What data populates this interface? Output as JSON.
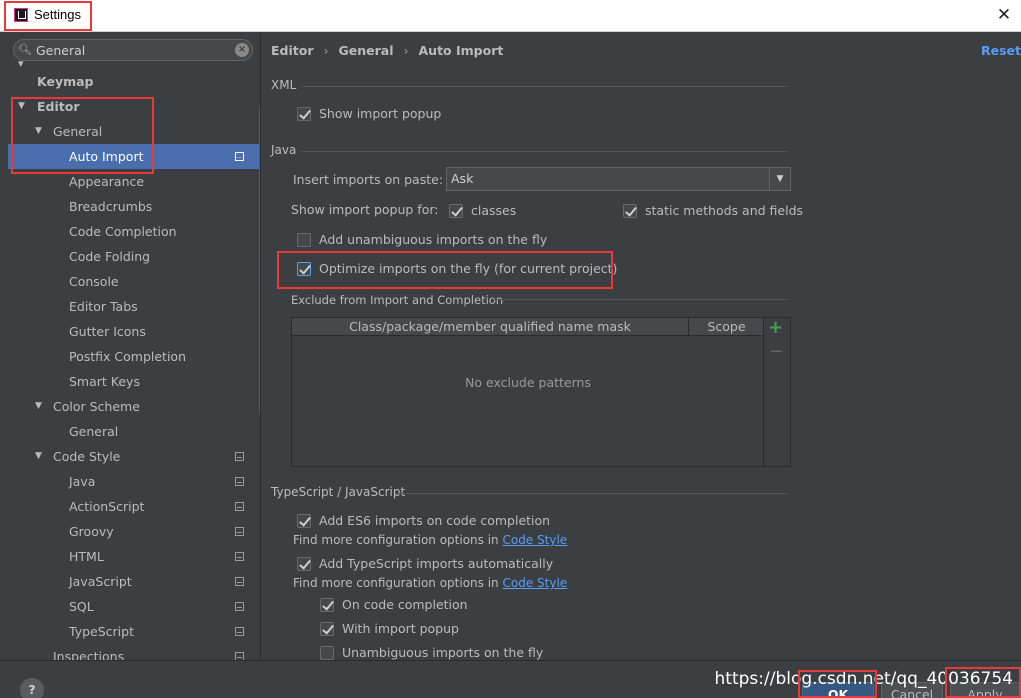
{
  "window": {
    "title": "Settings",
    "close_icon": "close-icon"
  },
  "sidebar": {
    "search": {
      "value": "General",
      "placeholder": ""
    },
    "items": [
      {
        "label": "Keymap"
      },
      {
        "label": "Editor"
      },
      {
        "label": "General"
      },
      {
        "label": "Auto Import"
      },
      {
        "label": "Appearance"
      },
      {
        "label": "Breadcrumbs"
      },
      {
        "label": "Code Completion"
      },
      {
        "label": "Code Folding"
      },
      {
        "label": "Console"
      },
      {
        "label": "Editor Tabs"
      },
      {
        "label": "Gutter Icons"
      },
      {
        "label": "Postfix Completion"
      },
      {
        "label": "Smart Keys"
      },
      {
        "label": "Color Scheme"
      },
      {
        "label": "General"
      },
      {
        "label": "Code Style"
      },
      {
        "label": "Java"
      },
      {
        "label": "ActionScript"
      },
      {
        "label": "Groovy"
      },
      {
        "label": "HTML"
      },
      {
        "label": "JavaScript"
      },
      {
        "label": "SQL"
      },
      {
        "label": "TypeScript"
      },
      {
        "label": "Inspections"
      }
    ]
  },
  "breadcrumb": {
    "items": [
      "Editor",
      "General",
      "Auto Import"
    ],
    "separator": "›"
  },
  "header": {
    "reset_label": "Reset"
  },
  "xml": {
    "title": "XML",
    "show_import_popup": {
      "label": "Show import popup",
      "checked": true
    }
  },
  "java": {
    "title": "Java",
    "insert_imports_label": "Insert imports on paste:",
    "insert_imports_value": "Ask",
    "show_popup_for_label": "Show import popup for:",
    "classes": {
      "label": "classes",
      "checked": true
    },
    "static_methods": {
      "label": "static methods and fields",
      "checked": true
    },
    "add_unambiguous": {
      "label": "Add unambiguous imports on the fly",
      "checked": false
    },
    "optimize_imports": {
      "label": "Optimize imports on the fly (for current project)",
      "checked": true
    },
    "exclude_title": "Exclude from Import and Completion",
    "table": {
      "columns": [
        "Class/package/member qualified name mask",
        "Scope"
      ],
      "empty_text": "No exclude patterns",
      "add_label": "+",
      "remove_label": "−"
    }
  },
  "typescript": {
    "title": "TypeScript / JavaScript",
    "add_es6": {
      "label": "Add ES6 imports on code completion",
      "checked": true
    },
    "hint1_text": "Find more configuration options in",
    "hint1_link": "Code Style",
    "add_ts": {
      "label": "Add TypeScript imports automatically",
      "checked": true
    },
    "hint2_text": "Find more configuration options in",
    "hint2_link": "Code Style",
    "on_completion": {
      "label": "On code completion",
      "checked": true
    },
    "with_popup": {
      "label": "With import popup",
      "checked": true
    },
    "unambiguous": {
      "label": "Unambiguous imports on the fly",
      "checked": false
    }
  },
  "buttons": {
    "help": "?",
    "ok": "OK",
    "cancel": "Cancel",
    "apply": "Apply"
  },
  "watermark": "https://blog.csdn.net/qq_40036754",
  "colors": {
    "selection": "#4b6eaf",
    "link": "#589df6",
    "highlight_box": "#e83a3a",
    "background": "#3c3f41"
  }
}
